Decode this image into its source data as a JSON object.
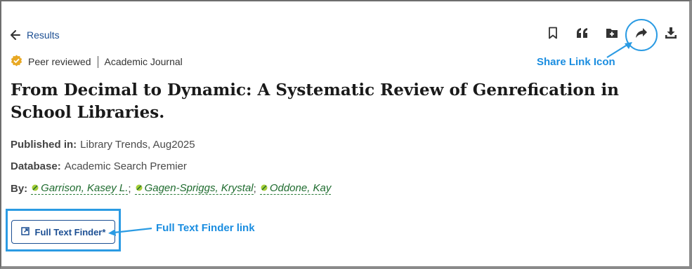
{
  "nav": {
    "back_label": "Results"
  },
  "toolbar": {
    "icons": [
      "bookmark-icon",
      "quote-icon",
      "add-to-folder-icon",
      "share-icon",
      "download-icon"
    ]
  },
  "annotations": {
    "share_label": "Share Link Icon",
    "ftf_label": "Full Text Finder link"
  },
  "record": {
    "peer_reviewed": "Peer reviewed",
    "type": "Academic Journal",
    "title": "From Decimal to Dynamic: A Systematic Review of Genrefication in School Libraries.",
    "published_label": "Published in:",
    "published_value": "Library Trends, Aug2025",
    "database_label": "Database:",
    "database_value": "Academic Search Premier",
    "by_label": "By:",
    "authors": [
      "Garrison, Kasey L.",
      "Gagen-Spriggs, Krystal",
      "Oddone, Kay"
    ],
    "author_sep": ";"
  },
  "full_text": {
    "label": "Full Text Finder*"
  },
  "colors": {
    "link": "#1c4f93",
    "annotation": "#2b9be3",
    "author": "#1e6b2e",
    "badge": "#e8a823"
  }
}
